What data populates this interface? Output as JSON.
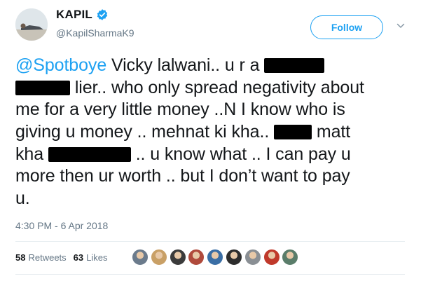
{
  "user": {
    "display_name": "KAPIL",
    "handle": "@KapilSharmaK9",
    "avatar_icon": "profile-avatar",
    "verified_icon": "verified-badge-icon"
  },
  "follow_label": "Follow",
  "tweet": {
    "lines": [
      {
        "mention": "@Spotboye",
        "text": " Vicky lalwani.. u r a "
      },
      {
        "text": " lier.. who only spread negativity about"
      },
      {
        "text": "me for a very little money ..N I know who is"
      },
      {
        "text": "giving u money .. mehnat ki kha.. ",
        "text2": " matt"
      },
      {
        "text": "kha ",
        "text2": " .. u know what ..  I can pay u"
      },
      {
        "text": "more then ur worth .. but I don’t want to pay"
      },
      {
        "text": "u."
      }
    ]
  },
  "timestamp": "4:30 PM - 6 Apr 2018",
  "stats": {
    "retweets_count": "58",
    "retweets_label": "Retweets",
    "likes_count": "63",
    "likes_label": "Likes"
  },
  "colors": {
    "accent": "#1da1f2",
    "secondary_text": "#657786",
    "text": "#14171a",
    "divider": "#e6ecf0"
  },
  "likers": [
    "#6b7b8c",
    "#c9a066",
    "#3b3b3b",
    "#b04a3c",
    "#3a6ea5",
    "#2d2d2d",
    "#8a8f94",
    "#c0392b",
    "#5a7d6a"
  ]
}
